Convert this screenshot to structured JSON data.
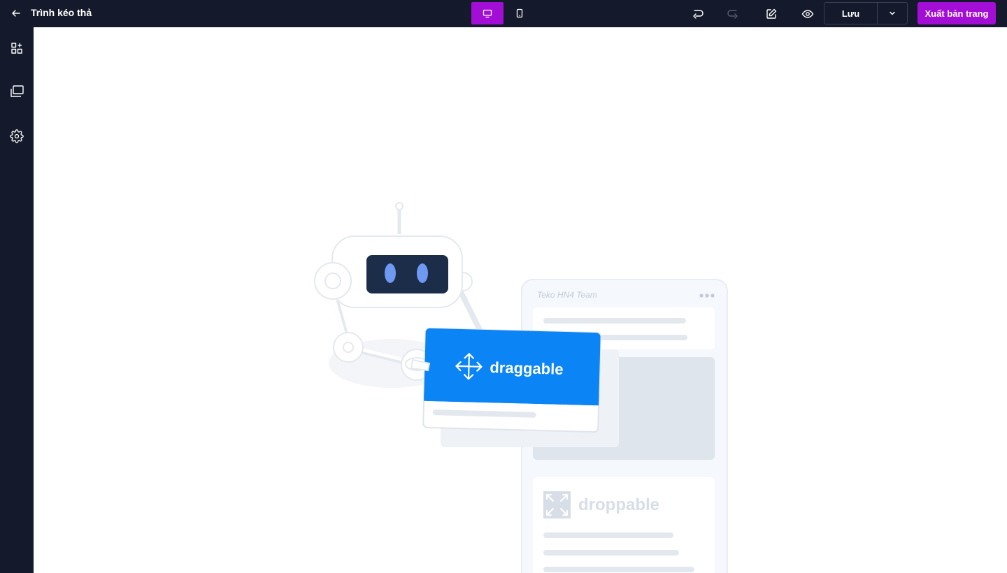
{
  "header": {
    "title": "Trình kéo thả",
    "save_label": "Lưu",
    "publish_label": "Xuất bản trang",
    "accent_color": "#a30ed6",
    "bar_color": "#141a2b",
    "devices": [
      {
        "icon": "desktop-icon",
        "active": true
      },
      {
        "icon": "mobile-icon",
        "active": false
      }
    ],
    "tools": [
      "undo-icon",
      "redo-icon",
      "edit-icon",
      "eye-icon"
    ]
  },
  "sidebar": {
    "items": [
      {
        "icon": "add-block-icon"
      },
      {
        "icon": "pages-icon"
      },
      {
        "icon": "gear-icon"
      }
    ]
  },
  "illustration": {
    "card_header": "Teko HN4 Team",
    "draggable_label": "draggable",
    "droppable_label": "droppable",
    "draggable_color": "#0b84f5"
  }
}
